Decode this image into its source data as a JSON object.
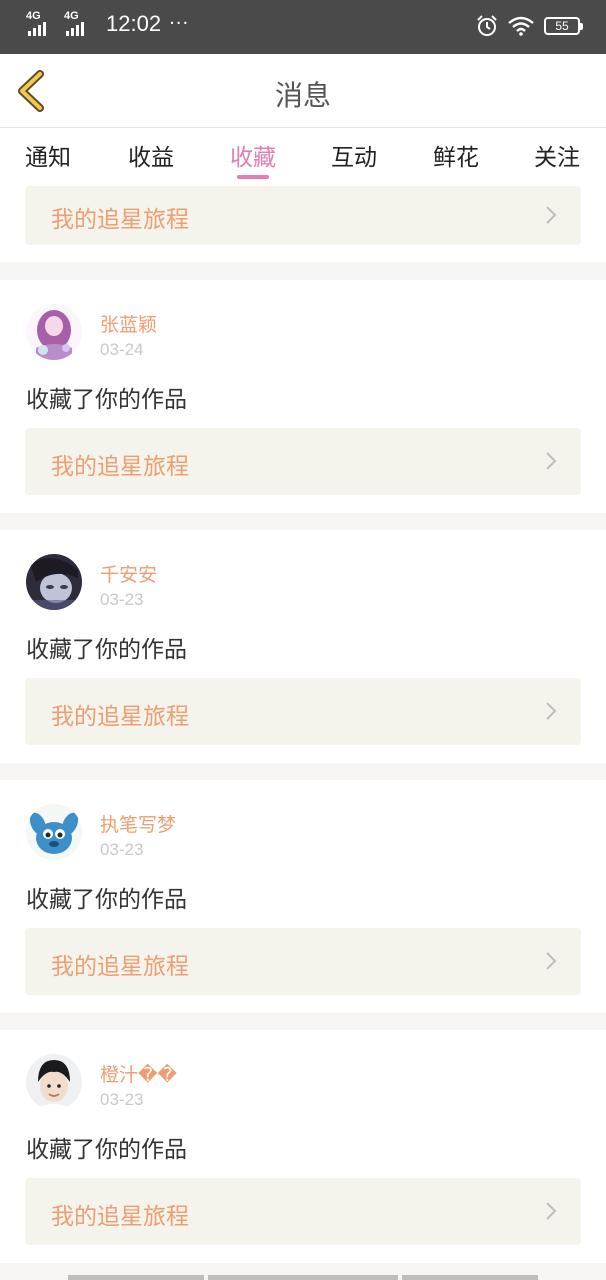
{
  "status_bar": {
    "signal1": "4G",
    "signal2": "4G",
    "time": "12:02",
    "more": "···",
    "battery": "55"
  },
  "header": {
    "title": "消息"
  },
  "tabs": [
    "通知",
    "收益",
    "收藏",
    "互动",
    "鲜花",
    "关注"
  ],
  "active_tab": "收藏",
  "colors": {
    "accent": "#e47db2",
    "link_text": "#ee9e72",
    "link_bg": "#f5f4ec",
    "statusbar": "#4a4a4a"
  },
  "partial_card": {
    "link": "我的追星旅程"
  },
  "messages": [
    {
      "user": "张蓝颖",
      "date": "03-24",
      "action": "收藏了你的作品",
      "link": "我的追星旅程"
    },
    {
      "user": "千安安",
      "date": "03-23",
      "action": "收藏了你的作品",
      "link": "我的追星旅程"
    },
    {
      "user": "执笔写梦",
      "date": "03-23",
      "action": "收藏了你的作品",
      "link": "我的追星旅程"
    },
    {
      "user": "橙汁��",
      "date": "03-23",
      "action": "收藏了你的作品",
      "link": "我的追星旅程"
    }
  ]
}
